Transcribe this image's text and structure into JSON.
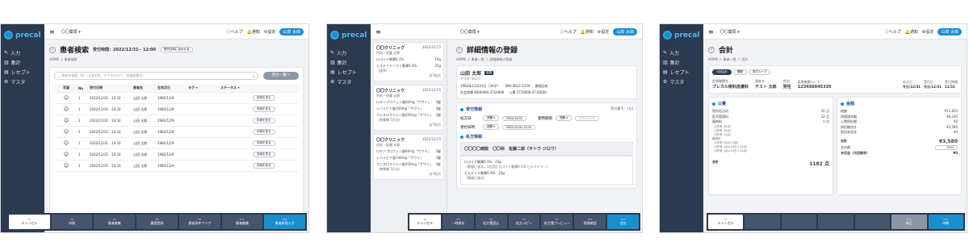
{
  "brand": "precal",
  "nav": [
    "入力",
    "集計",
    "レセプト",
    "マスタ"
  ],
  "topbar": {
    "pharmacy": "〇〇薬局 ▾",
    "help": "ヘルプ",
    "notice": "通知",
    "settings": "設定",
    "user": "山田 太郎"
  },
  "p1": {
    "title": "患者検索",
    "date_label": "受付時間：2022/12/31 - 12:00",
    "date_btn": "受付日時に合わせる",
    "breadcrumb": "HOME ＞ 患者検索",
    "search_placeholder": "患者名検索（例：山田太郎、ヤマダタロウ、保険者番号）",
    "list_btn": "受付一覧へ",
    "headers": [
      "写真",
      "No",
      "受付日時",
      "患者名",
      "生年月日",
      "タグ ▾",
      "ステータス ▾"
    ],
    "rows": [
      {
        "no": "1",
        "time": "2022/12/31 - 10:32",
        "name": "山田 太郎",
        "dob": "1982/12/9",
        "btn": "詳細を見る"
      },
      {
        "no": "1",
        "time": "2022/12/31 - 10:32",
        "name": "山田 太郎",
        "dob": "1982/12/9",
        "btn": "詳細を見る"
      },
      {
        "no": "1",
        "time": "2022/12/31 - 10:32",
        "name": "山田 太郎",
        "dob": "1982/12/9",
        "btn": "詳細を見る"
      },
      {
        "no": "1",
        "time": "2022/12/31 - 10:32",
        "name": "山田 太郎",
        "dob": "1982/12/9",
        "btn": "詳細を見る"
      },
      {
        "no": "1",
        "time": "2022/12/31 - 10:32",
        "name": "山田 太郎",
        "dob": "1982/12/9",
        "btn": "詳細を見る"
      },
      {
        "no": "1",
        "time": "2022/12/31 - 10:32",
        "name": "山田 太郎",
        "dob": "1982/12/9",
        "btn": "詳細を見る"
      },
      {
        "no": "1",
        "time": "2022/12/31 - 10:32",
        "name": "山田 太郎",
        "dob": "1982/12/9",
        "btn": "詳細を見る"
      }
    ],
    "fkeys": [
      {
        "k": "F1",
        "l": "キャンセル"
      },
      {
        "k": "F2",
        "l": "印刷"
      },
      {
        "k": "F3",
        "l": "患者編集"
      },
      {
        "k": "F4",
        "l": "履歴登録"
      },
      {
        "k": "F5",
        "l": "患者条件クリア"
      },
      {
        "k": "F11",
        "l": "患者編集"
      },
      {
        "k": "F12",
        "l": "患者新規入力"
      }
    ]
  },
  "p2": {
    "clinics": [
      {
        "name": "〇〇クリニック",
        "date": "2022/12/15",
        "sub": "内科・佐藤 太郎",
        "items": [
          [
            "ロコイド軟膏0.1%",
            "10g"
          ],
          [
            "ヒルドイドソフト軟膏0.3%",
            "25g"
          ]
        ],
        "foot": "（塗布）",
        "count": "計7処方"
      },
      {
        "name": "〇〇クリニック",
        "date": "2022/12/15",
        "sub": "内科・佐藤 太郎",
        "items": [
          [
            "ロキソプロフェン錠60mg「サワイ」",
            "3錠"
          ],
          [
            "レバミピド錠100mg「サワイ」",
            "3錠"
          ],
          [
            "アジスロマイシン錠250mg「サワイ」",
            "3錠"
          ]
        ],
        "foot": "（毎食後 5日分）",
        "count": "計7処方"
      },
      {
        "name": "〇〇クリニック",
        "date": "2022/12/15",
        "sub": "内科・佐藤 太郎",
        "items": [
          [
            "ロキソプロフェン錠60mg「サワイ」",
            "3錠"
          ],
          [
            "レバミピド錠100mg「サワイ」",
            "3錠"
          ],
          [
            "アジスロマイシン錠250mg「サワイ」",
            "3錠"
          ]
        ],
        "foot": "（毎食後 5日分）",
        "count": "計7処方"
      }
    ],
    "title": "詳細情報の登録",
    "breadcrumb": "HOME ＞ 患者一覧 ＞ 詳細情報の登録",
    "patient": "山田 太郎",
    "patient_kana": "ヤマダ タロウ",
    "patient_badge": "新患",
    "dob": "1982年12月31日（34才）",
    "tel": "090-4612-1234",
    "insurer": "保険証有",
    "insurance": "社会保険 8000000-3710000",
    "public": "公費 2710000-3710000",
    "accept_label": "受付情報",
    "accept_no": "受付番号：103",
    "date_label": "処方日",
    "era": "西暦 ▾",
    "date_val": "2022/12/31",
    "use_label": "使用期限",
    "era2": "西暦 ▾",
    "use_val": "2022/12/31",
    "recv_label": "受付日時",
    "recv_val": "2022/12/31-12:31",
    "rx_label": "処方情報",
    "doctor": "〇〇〇〇病院　〇〇科　佐藤二郎（サトウ ジロウ）",
    "rx1": "ロコイド軟膏0.1%　25g",
    "rx1_note": "（患部に塗る、1日2回 ロコイド軟膏0.1% ヒルドイド...）",
    "rx2": "ヒルドイド軟膏0.3%　25g",
    "rx2_note": "（患部に塗る）",
    "fkeys": [
      {
        "k": "F1",
        "l": "キャンセル"
      },
      {
        "k": "F2",
        "l": "一時保存"
      },
      {
        "k": "F3",
        "l": "処方箋読込"
      },
      {
        "k": "F4",
        "l": "処方コピー"
      },
      {
        "k": "F5",
        "l": "処方箋プレビュー"
      },
      {
        "k": "F11",
        "l": "保険確認"
      },
      {
        "k": "F12",
        "l": "会計"
      }
    ]
  },
  "p3": {
    "title": "会計",
    "breadcrumb": "HOME ＞ 患者一覧 ＞ 会計",
    "tabs": [
      "今回会計",
      "履歴",
      "同グループ"
    ],
    "hdr": [
      [
        "医療機関名",
        "プレカル眼科皮膚科",
        "患者名",
        "テスト 太郎",
        "性別",
        "男性",
        "医療機関コード",
        "123456045335"
      ]
    ],
    "dates": [
      [
        "処方日",
        "令元/12/31"
      ],
      [
        "受付日",
        "令元/12/31"
      ],
      [
        "受付時間",
        "11:52"
      ]
    ],
    "left_title": "公費",
    "left": [
      [
        "院外処方料",
        "35 点"
      ],
      [
        "医学管理料",
        "32 点"
      ],
      [
        "薬剤料",
        "0 点"
      ]
    ],
    "left2": [
      "（1外来 35点）",
      "（2外来 24点）",
      "（3外来 24点）",
      "薬剤料",
      "（1外来 20点×1回）",
      "（2外来 1点×14日＝14点）",
      "（3外来 1点×14日＝14点）"
    ],
    "left_total_label": "合計",
    "left_total": "1182 点",
    "right_title": "金額",
    "right": [
      [
        "総額",
        "¥11,820"
      ],
      [
        "保険請求額",
        "¥8,240"
      ],
      [
        "公費負担額",
        "¥0"
      ],
      [
        "負担額合計",
        "¥3,580"
      ],
      [
        "前回未収金",
        "¥0"
      ]
    ],
    "total_label": "合計",
    "total": "¥3,580",
    "paid_label": "支払額",
    "paid": "3580",
    "balance_label": "未収金（次回請求）",
    "balance": "¥0",
    "fkeys": [
      {
        "k": "F1",
        "l": "キャンセル"
      },
      {
        "k": "",
        "l": ""
      },
      {
        "k": "",
        "l": ""
      },
      {
        "k": "",
        "l": ""
      },
      {
        "k": "",
        "l": ""
      },
      {
        "k": "F11",
        "l": "修正"
      },
      {
        "k": "F12",
        "l": "印刷"
      }
    ]
  }
}
